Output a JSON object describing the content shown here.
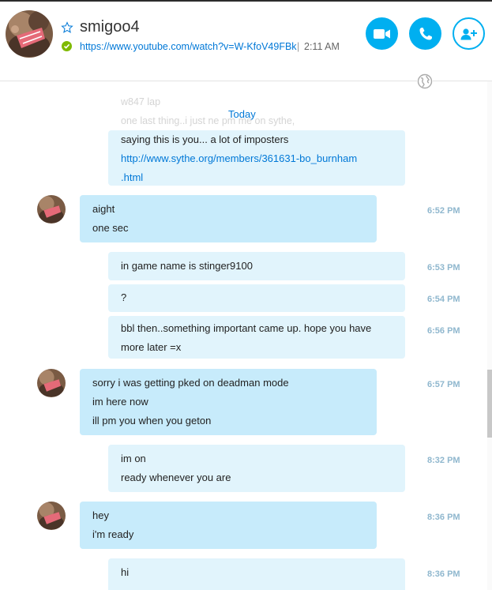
{
  "header": {
    "contact_name": "smigoo4",
    "mood_link": "https://www.youtube.com/watch?v=W-KfoV49FBk",
    "separator": "|",
    "local_time": "2:11 AM",
    "status": "online",
    "status_color": "#7fba00",
    "accent_color": "#00aff0",
    "buttons": [
      {
        "icon": "video-camera-icon"
      },
      {
        "icon": "phone-icon"
      },
      {
        "icon": "add-contact-icon"
      }
    ]
  },
  "conversation": {
    "faded_lines": [
      "w847 lap",
      "one last thing..i just ne      pm me on sythe,"
    ],
    "day_label": "Today",
    "messages": [
      {
        "direction": "out",
        "lines": [
          "saying this is you... a lot of imposters"
        ],
        "link_lines": [
          "http://www.sythe.org/members/361631-bo_burnham",
          ".html"
        ],
        "time": ""
      },
      {
        "direction": "in",
        "lines": [
          "aight",
          "one sec"
        ],
        "time": "6:52 PM"
      },
      {
        "direction": "out",
        "lines": [
          "in game name is stinger9100"
        ],
        "time": "6:53 PM"
      },
      {
        "direction": "out",
        "lines": [
          "?"
        ],
        "time": "6:54 PM"
      },
      {
        "direction": "out",
        "lines": [
          "bbl then..something important came up. hope you have",
          "more later =x"
        ],
        "time": "6:56 PM"
      },
      {
        "direction": "in",
        "lines": [
          "sorry i was getting pked on deadman mode",
          "im here now",
          "ill pm you when you geton"
        ],
        "time": "6:57 PM"
      },
      {
        "direction": "out",
        "lines": [
          "im on",
          "ready whenever you are"
        ],
        "time": "8:32 PM"
      },
      {
        "direction": "in",
        "lines": [
          "hey",
          "i'm ready"
        ],
        "time": "8:36 PM"
      },
      {
        "direction": "out",
        "lines": [
          "hi"
        ],
        "time": "8:36 PM"
      }
    ]
  },
  "colors": {
    "outgoing_bubble": "#e1f4fc",
    "incoming_bubble": "#c7ebfb",
    "timestamp": "#8fb7ce",
    "link": "#0078d7"
  }
}
